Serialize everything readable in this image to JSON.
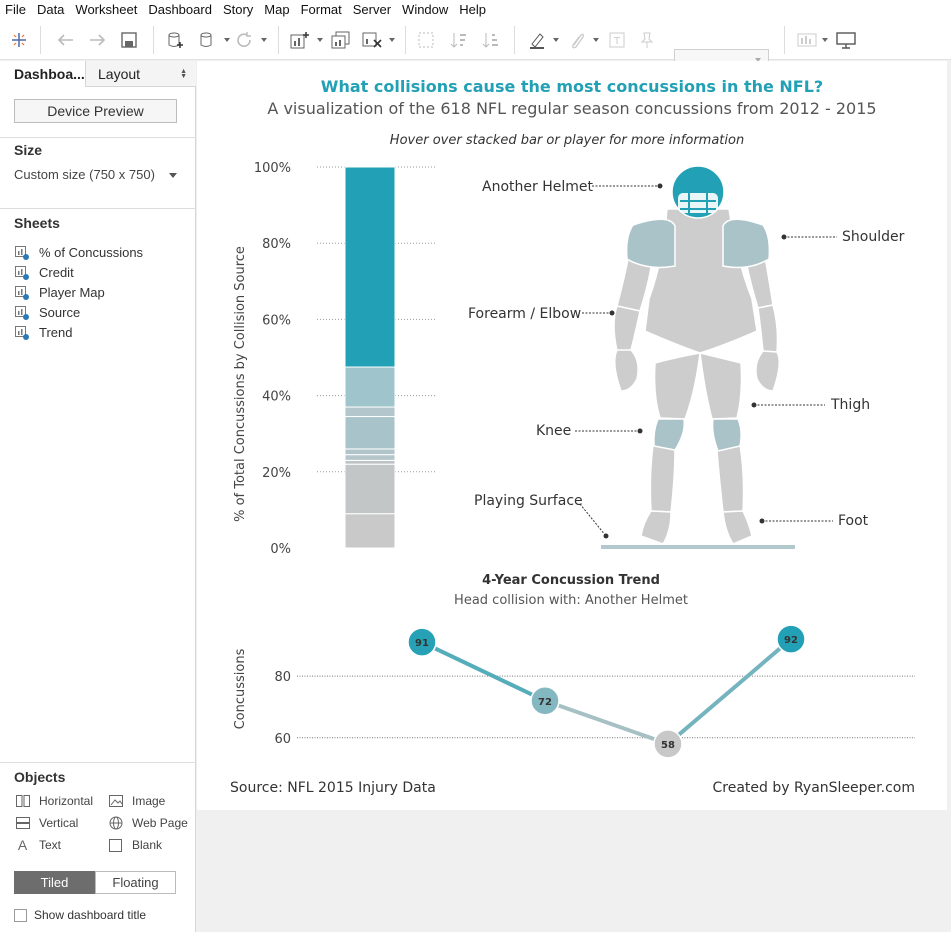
{
  "menu": [
    "File",
    "Data",
    "Worksheet",
    "Dashboard",
    "Story",
    "Map",
    "Format",
    "Server",
    "Window",
    "Help"
  ],
  "sidebar": {
    "tab_dashboard": "Dashboa...",
    "tab_layout": "Layout",
    "device_preview": "Device Preview",
    "size_heading": "Size",
    "size_value": "Custom size (750 x 750)",
    "sheets_heading": "Sheets",
    "sheets": [
      "% of Concussions",
      "Credit",
      "Player Map",
      "Source",
      "Trend"
    ],
    "objects_heading": "Objects",
    "objects": [
      {
        "label": "Horizontal",
        "icon": "horizontal-container-icon"
      },
      {
        "label": "Image",
        "icon": "image-icon"
      },
      {
        "label": "Vertical",
        "icon": "vertical-container-icon"
      },
      {
        "label": "Web Page",
        "icon": "globe-icon"
      },
      {
        "label": "Text",
        "icon": "text-icon"
      },
      {
        "label": "Blank",
        "icon": "blank-icon"
      }
    ],
    "tiled": "Tiled",
    "floating": "Floating",
    "show_title": "Show dashboard title"
  },
  "dashboard": {
    "title": "What collisions cause the most concussions in the NFL?",
    "subtitle": "A visualization of the 618 NFL regular season concussions from 2012 - 2015",
    "hover_note": "Hover over stacked bar or player for more information",
    "footer_source": "Source: NFL 2015 Injury Data",
    "footer_credit": "Created by RyanSleeper.com",
    "body_labels": [
      "Another Helmet",
      "Shoulder",
      "Forearm / Elbow",
      "Thigh",
      "Knee",
      "Playing Surface",
      "Foot"
    ],
    "accent_color": "#22a0b5"
  },
  "chart_data": [
    {
      "type": "bar",
      "stacked": true,
      "ylabel": "% of Total Concussions by Collision Source",
      "ylim": [
        0,
        100
      ],
      "yticks": [
        "0%",
        "20%",
        "40%",
        "60%",
        "80%",
        "100%"
      ],
      "series": [
        {
          "value": 9,
          "color": "#c9c9c9"
        },
        {
          "value": 13,
          "color": "#c2c6c7"
        },
        {
          "value": 1,
          "color": "#bec4c6"
        },
        {
          "value": 1.5,
          "color": "#b5c6ca"
        },
        {
          "value": 1.5,
          "color": "#b0c4c9"
        },
        {
          "value": 8.5,
          "color": "#a8c3c9"
        },
        {
          "value": 2.5,
          "color": "#b2c6cb"
        },
        {
          "value": 10.5,
          "color": "#9fc4cc"
        },
        {
          "value": 52.5,
          "color": "#22a0b5"
        }
      ]
    },
    {
      "type": "line",
      "title": "4-Year Concussion Trend",
      "subtitle": "Head collision with: Another Helmet",
      "ylabel": "Concussions",
      "yticks": [
        60,
        80
      ],
      "ylim": [
        57,
        93
      ],
      "values": [
        91,
        72,
        58,
        92
      ]
    }
  ]
}
